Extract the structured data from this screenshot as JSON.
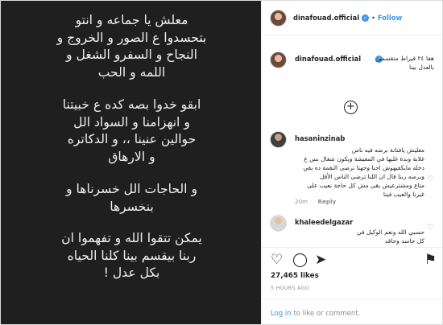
{
  "post": {
    "image_text": [
      "معلش يا جماعه و انتو\nبتحسدوا ع الصور و الخروج و\nالنجاح و السفرو الشغل و\nاللمه و الحب",
      "ابقو خدوا بصه كده ع خبيتنا\nو انهزامنا و السواد الل\nحوالين عنينا ،، و الدكاتره\nو الارهاق",
      "و الحاجات الل خسرناها و\nبنخسرها",
      "يمكن تتقوا الله و تفهموا ان\nربنا بيقسم بينا كلنا الحياه\nبكل عدل !"
    ]
  },
  "header": {
    "username": "dinafouad.official",
    "dot": "•",
    "follow": "Follow",
    "verified_color": "#3897f0"
  },
  "caption": {
    "username": "dinafouad.official",
    "text": "هفا ٢٤ قيراط متقسمين بالعدل بينا"
  },
  "comments": [
    {
      "username": "hasaninzinab",
      "text": "معليش يافنانة برضه فيه ناس\nغلابة وبدة غلبها في المعيشة ويكون شغال بس ع\nدخله مايكفيهوش احنا وجهنا نرضى النقمة ده يقي\nوبرضه ربنا قال ان اللنا ترضى الناس الأقل\nمتاع ومشترعيش بقى مش كل حاجة نعيب على\nغيرنا والعيب فينا",
      "time": "20m",
      "reply": "Reply"
    },
    {
      "username": "khaleedelgazar",
      "text": "حسبي الله ونعم الوكيل في\nكل حاسد وحاقد",
      "time": "",
      "reply": ""
    }
  ],
  "actions": {
    "likes": "27,465 likes",
    "time": "5 HOURS AGO"
  },
  "login": {
    "link": "Log in",
    "rest": "to like or comment."
  },
  "icons": {
    "add": "+",
    "heart": "♡",
    "like": "♡",
    "comment": "◯",
    "share": "➤",
    "save": "⚑",
    "verified": "✓"
  }
}
